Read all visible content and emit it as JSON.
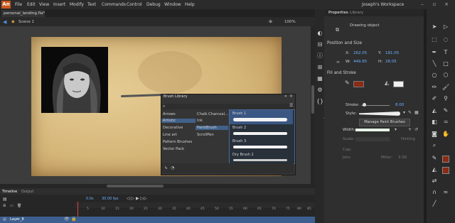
{
  "app": {
    "logo": "An"
  },
  "menu": [
    "File",
    "Edit",
    "View",
    "Insert",
    "Modify",
    "Text",
    "Commands",
    "Control",
    "Debug",
    "Window",
    "Help"
  ],
  "workspace": "Joseph's Workspace",
  "document": {
    "tab": "personal_landing.fla*",
    "scene": "Scene 1",
    "zoom": "100%"
  },
  "properties": {
    "tabs": [
      "Properties",
      "Library"
    ],
    "object_type": "Drawing object",
    "position_section": "Position and Size",
    "x_label": "X:",
    "x_value": "262.05",
    "y_label": "Y:",
    "y_value": "181.05",
    "w_label": "W:",
    "w_value": "449.85",
    "h_label": "H:",
    "h_value": "28.05",
    "fill_section": "Fill and Stroke",
    "stroke_label": "Stroke:",
    "stroke_value": "8.00",
    "style_label": "Style:",
    "manage_button": "Manage Paint Brushes",
    "width_label": "Width:",
    "scale_label": "Scale:",
    "hinting_label": "Hinting",
    "cap_label": "Cap:",
    "join_label": "Join:",
    "miter_label": "Miter:",
    "miter_value": "3.00"
  },
  "brush_library": {
    "title": "Brush Library",
    "categories": [
      "Arrows",
      "Artistic",
      "Decorative",
      "Line art",
      "Pattern Brushes",
      "Vector Pack"
    ],
    "selected_category": "Artistic",
    "subcategories": [
      "Chalk Charcoal...",
      "Ink",
      "PaintBrush",
      "ScrollPen"
    ],
    "selected_subcategory": "PaintBrush",
    "brushes": [
      "Brush 1",
      "Brush 2",
      "Brush 3",
      "Dry Brush 2"
    ]
  },
  "timeline": {
    "tabs": [
      "Timeline",
      "Output"
    ],
    "fps": "30.00 fps",
    "frame": "0.0s",
    "layer": "Layer_8",
    "ruler": [
      "5",
      "10",
      "15",
      "20",
      "25",
      "30",
      "35",
      "40",
      "45",
      "50",
      "55",
      "60",
      "65",
      "70",
      "75",
      "80",
      "85"
    ]
  },
  "colors": {
    "stroke": "#8c2a14",
    "fill": "#f0f0f0",
    "accent": "#c9571b"
  }
}
